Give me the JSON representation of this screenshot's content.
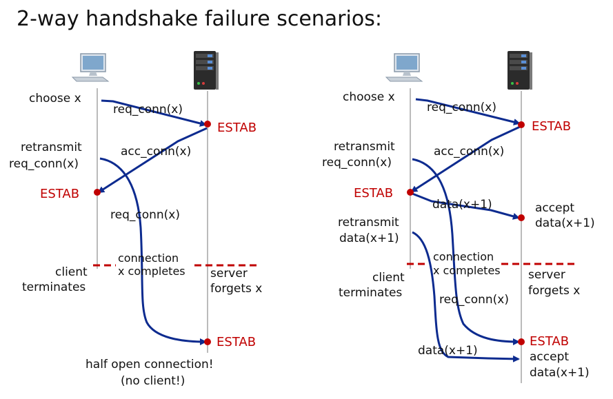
{
  "title": "2-way handshake failure scenarios:",
  "colors": {
    "arrow": "#0d2b8f",
    "state": "#c00000",
    "lifeline": "#777777"
  },
  "icons": {
    "client": "desktop-computer-icon",
    "server": "server-tower-icon"
  },
  "left": {
    "choose": "choose x",
    "req1": "req_conn(x)",
    "estab_server": "ESTAB",
    "retransmit": "retransmit",
    "retransmit_req": "req_conn(x)",
    "acc": "acc_conn(x)",
    "estab_client": "ESTAB",
    "req2": "req_conn(x)",
    "connection": "connection",
    "completes": "x completes",
    "client_l1": "client",
    "client_l2": "terminates",
    "server_l1": "server",
    "server_l2": "forgets x",
    "estab_late": "ESTAB",
    "caption_l1": "half open connection!",
    "caption_l2": "(no client!)"
  },
  "right": {
    "choose": "choose x",
    "req1": "req_conn(x)",
    "estab_server": "ESTAB",
    "retransmit": "retransmit",
    "retransmit_req": "req_conn(x)",
    "acc": "acc_conn(x)",
    "estab_client": "ESTAB",
    "data1": "data(x+1)",
    "accept_l1": "accept",
    "accept_l2": "data(x+1)",
    "retransmit_data_l1": "retransmit",
    "retransmit_data_l2": "data(x+1)",
    "connection": "connection",
    "completes": "x completes",
    "client_l1": "client",
    "client_l2": "terminates",
    "server_l1": "server",
    "server_l2": "forgets x",
    "req2": "req_conn(x)",
    "estab_late": "ESTAB",
    "data2": "data(x+1)",
    "accept2_l1": "accept",
    "accept2_l2": "data(x+1)"
  }
}
